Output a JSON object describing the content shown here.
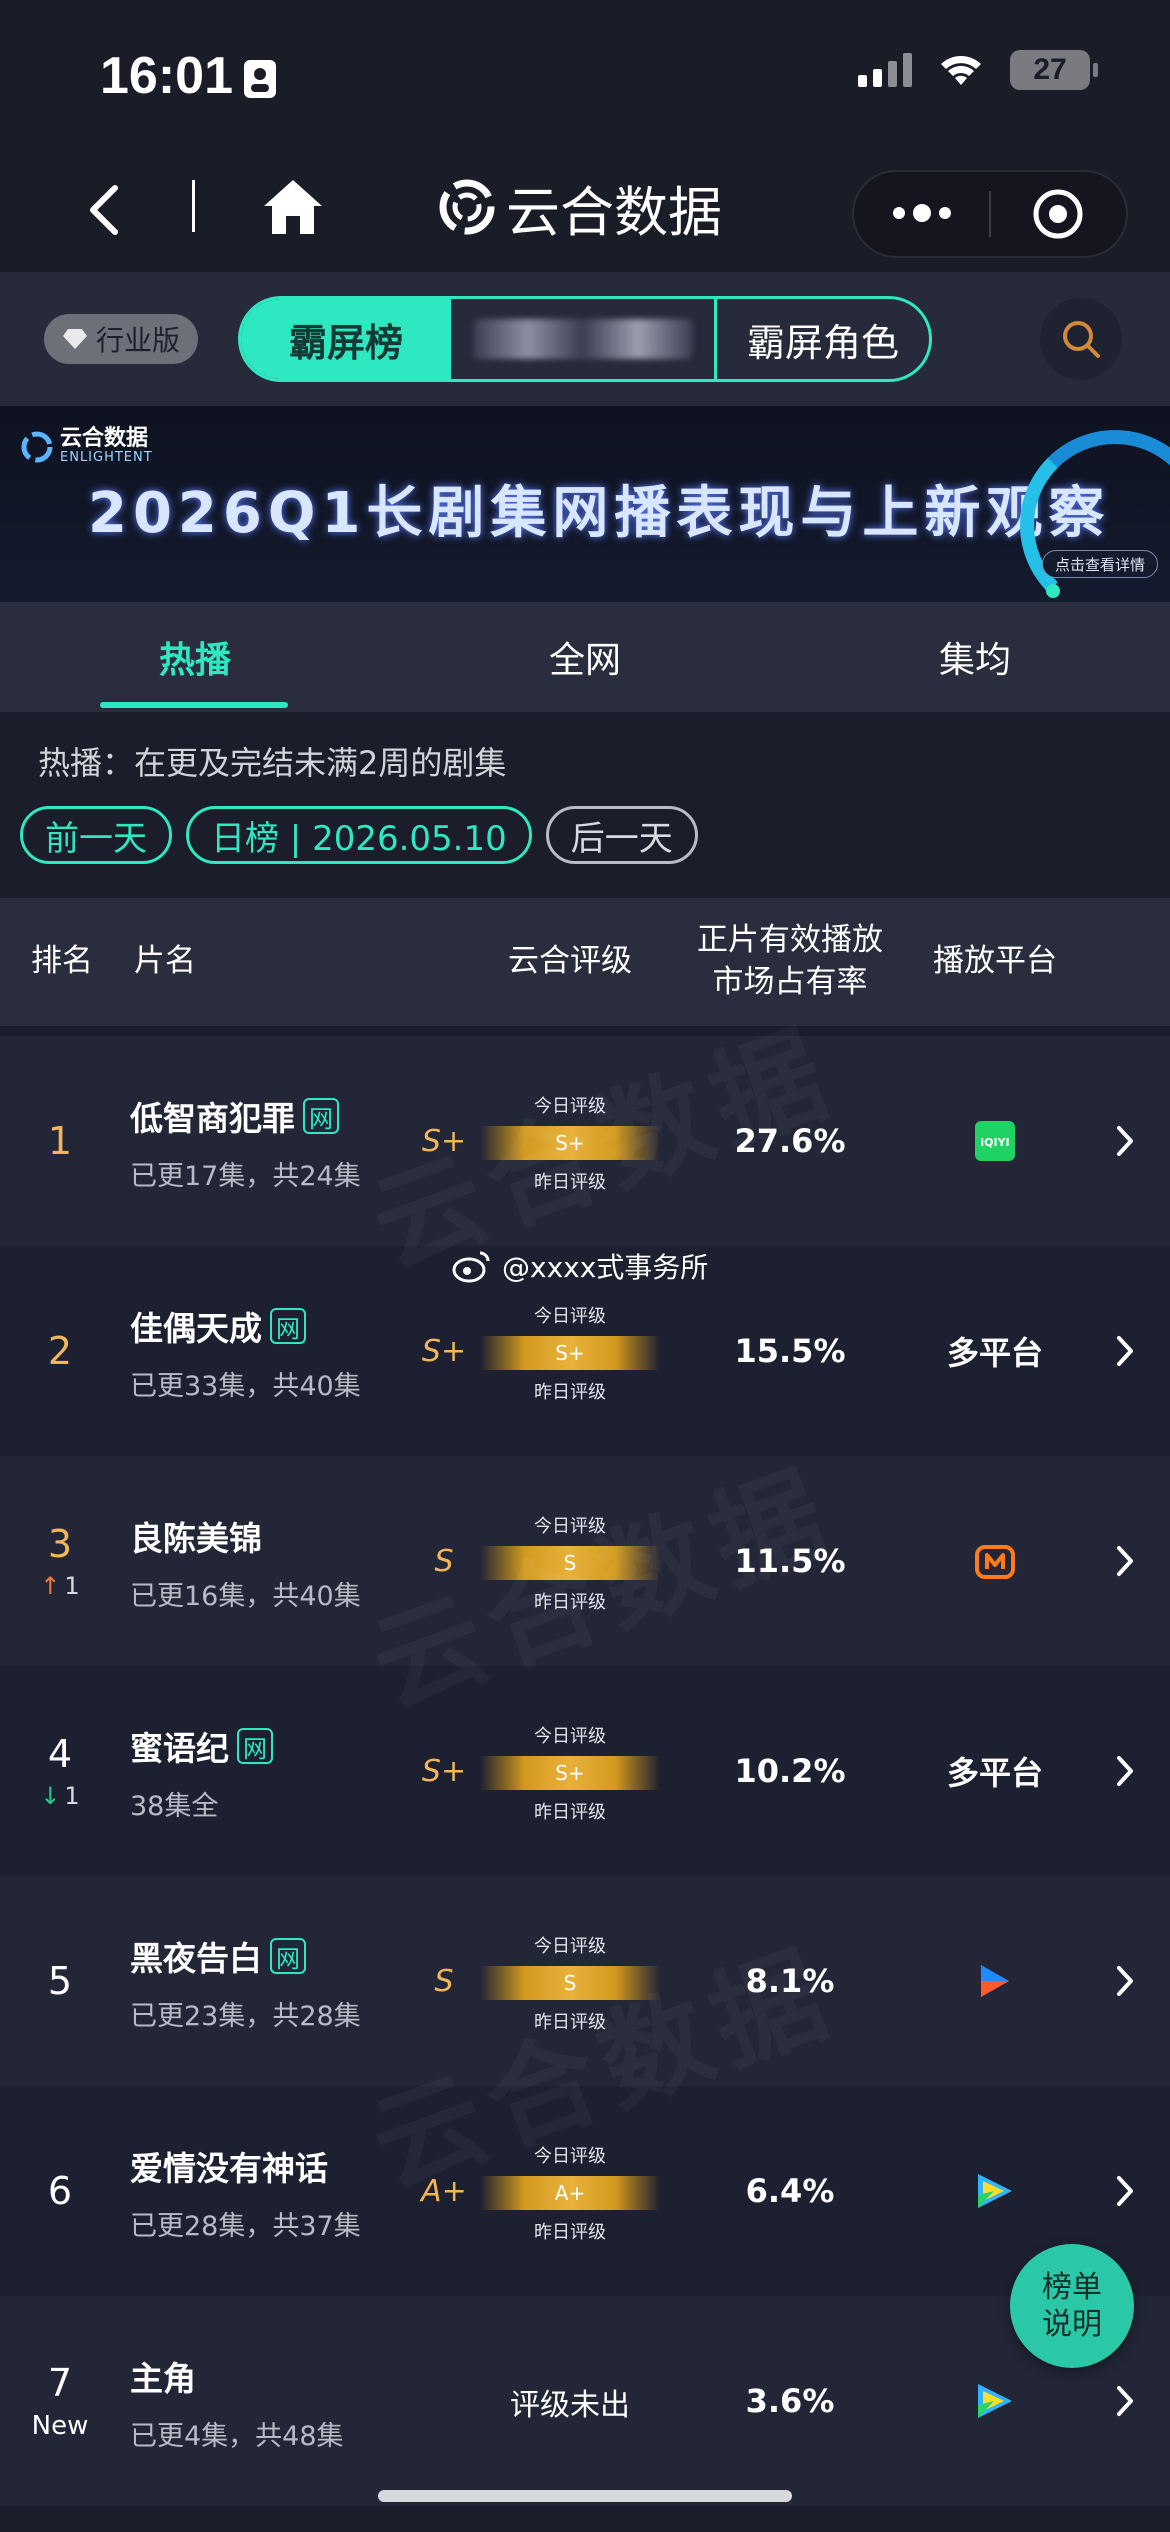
{
  "status_bar": {
    "time": "16:01",
    "battery": "27"
  },
  "nav": {
    "title": "云合数据"
  },
  "filter": {
    "edition": "行业版",
    "segments": [
      "霸屏榜",
      "",
      "霸屏角色"
    ]
  },
  "banner": {
    "logo_text": "云合数据",
    "logo_sub": "ENLIGHTENT",
    "title": "2026Q1长剧集网播表现与上新观察",
    "button": "点击查看详情"
  },
  "tabs": [
    "热播",
    "全网",
    "集均"
  ],
  "description": "热播：在更及完结未满2周的剧集",
  "date_nav": {
    "prev": "前一天",
    "current": "日榜 | 2026.05.10",
    "next": "后一天"
  },
  "table_header": {
    "rank": "排名",
    "title": "片名",
    "rating": "云合评级",
    "share_line1": "正片有效播放",
    "share_line2": "市场占有率",
    "platform": "播放平台"
  },
  "rating_labels": {
    "today": "今日评级",
    "yesterday": "昨日评级"
  },
  "net_tag": "网",
  "rows": [
    {
      "rank": "1",
      "change_dir": "",
      "change": "",
      "title": "低智商犯罪",
      "net": true,
      "episodes": "已更17集，共24集",
      "prev_grade": "S+",
      "grade": "S+",
      "share": "27.6%",
      "platform": "",
      "platform_icon": "iqiyi-icon"
    },
    {
      "rank": "2",
      "change_dir": "",
      "change": "",
      "title": "佳偶天成",
      "net": true,
      "episodes": "已更33集，共40集",
      "prev_grade": "S+",
      "grade": "S+",
      "share": "15.5%",
      "platform": "多平台",
      "platform_icon": ""
    },
    {
      "rank": "3",
      "change_dir": "up",
      "change": "1",
      "title": "良陈美锦",
      "net": false,
      "episodes": "已更16集，共40集",
      "prev_grade": "S",
      "grade": "S",
      "share": "11.5%",
      "platform": "",
      "platform_icon": "mango-tv-icon"
    },
    {
      "rank": "4",
      "change_dir": "down",
      "change": "1",
      "title": "蜜语纪",
      "net": true,
      "episodes": "38集全",
      "prev_grade": "S+",
      "grade": "S+",
      "share": "10.2%",
      "platform": "多平台",
      "platform_icon": ""
    },
    {
      "rank": "5",
      "change_dir": "",
      "change": "",
      "title": "黑夜告白",
      "net": true,
      "episodes": "已更23集，共28集",
      "prev_grade": "S",
      "grade": "S",
      "share": "8.1%",
      "platform": "",
      "platform_icon": "youku-icon"
    },
    {
      "rank": "6",
      "change_dir": "",
      "change": "",
      "title": "爱情没有神话",
      "net": false,
      "episodes": "已更28集，共37集",
      "prev_grade": "A+",
      "grade": "A+",
      "share": "6.4%",
      "platform": "",
      "platform_icon": "tencent-video-icon"
    },
    {
      "rank": "7",
      "change_dir": "new",
      "change": "New",
      "title": "主角",
      "net": false,
      "episodes": "已更4集，共48集",
      "prev_grade": "",
      "grade": "评级未出",
      "share": "3.6%",
      "platform": "",
      "platform_icon": "tencent-video-icon"
    }
  ],
  "watermark": "@xxxx式事务所",
  "fab": {
    "line1": "榜单",
    "line2": "说明"
  },
  "colors": {
    "accent": "#2ee8c2",
    "gold": "#f2b55a",
    "background": "#1b1d2a"
  }
}
